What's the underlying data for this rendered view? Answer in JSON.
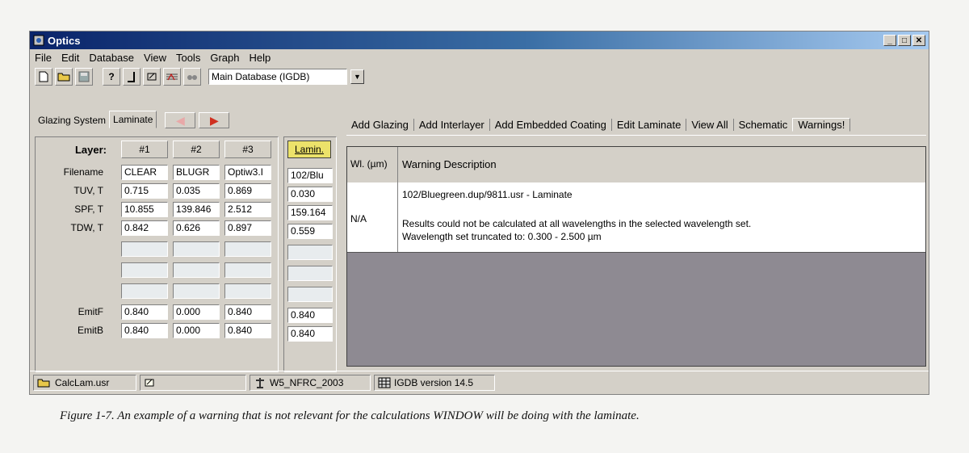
{
  "window": {
    "title": "Optics",
    "controls": [
      "_",
      "□",
      "✕"
    ]
  },
  "menu": [
    "File",
    "Edit",
    "Database",
    "View",
    "Tools",
    "Graph",
    "Help"
  ],
  "toolbar": {
    "database_select": "Main Database (IGDB)"
  },
  "left_tabs": {
    "glazing_system": "Glazing System",
    "laminate": "Laminate"
  },
  "layer_table": {
    "layer_label": "Layer:",
    "headers": [
      "#1",
      "#2",
      "#3"
    ],
    "laminate_header": "Lamin.",
    "row_labels": [
      "Filename",
      "TUV, T",
      "SPF, T",
      "TDW, T",
      "",
      "",
      "",
      "EmitF",
      "EmitB"
    ],
    "rows": [
      [
        "CLEAR",
        "BLUGR",
        "Optiw3.I"
      ],
      [
        "0.715",
        "0.035",
        "0.869"
      ],
      [
        "10.855",
        "139.846",
        "2.512"
      ],
      [
        "0.842",
        "0.626",
        "0.897"
      ],
      [
        "",
        "",
        ""
      ],
      [
        "",
        "",
        ""
      ],
      [
        "",
        "",
        ""
      ],
      [
        "0.840",
        "0.000",
        "0.840"
      ],
      [
        "0.840",
        "0.000",
        "0.840"
      ]
    ],
    "laminate_values": [
      "102/Blu",
      "0.030",
      "159.164",
      "0.559",
      "",
      "",
      "",
      "0.840",
      "0.840"
    ]
  },
  "right_tabs": [
    "Add Glazing",
    "Add Interlayer",
    "Add Embedded Coating",
    "Edit Laminate",
    "View All",
    "Schematic",
    "Warnings!"
  ],
  "warnings_grid": {
    "col_wl": "Wl. (µm)",
    "col_desc": "Warning Description",
    "row": {
      "wl": "N/A",
      "line1": "102/Bluegreen.dup/9811.usr - Laminate",
      "line2": "Results could not be calculated at all wavelengths in the selected wavelength set.",
      "line3": "Wavelength set truncated to: 0.300 - 2.500 µm"
    }
  },
  "status": {
    "file": "CalcLam.usr",
    "standard": "W5_NFRC_2003",
    "igdb": "IGDB version 14.5"
  },
  "caption": "Figure 1-7. An example of a warning that is not relevant for the calculations WINDOW will be doing with the laminate."
}
